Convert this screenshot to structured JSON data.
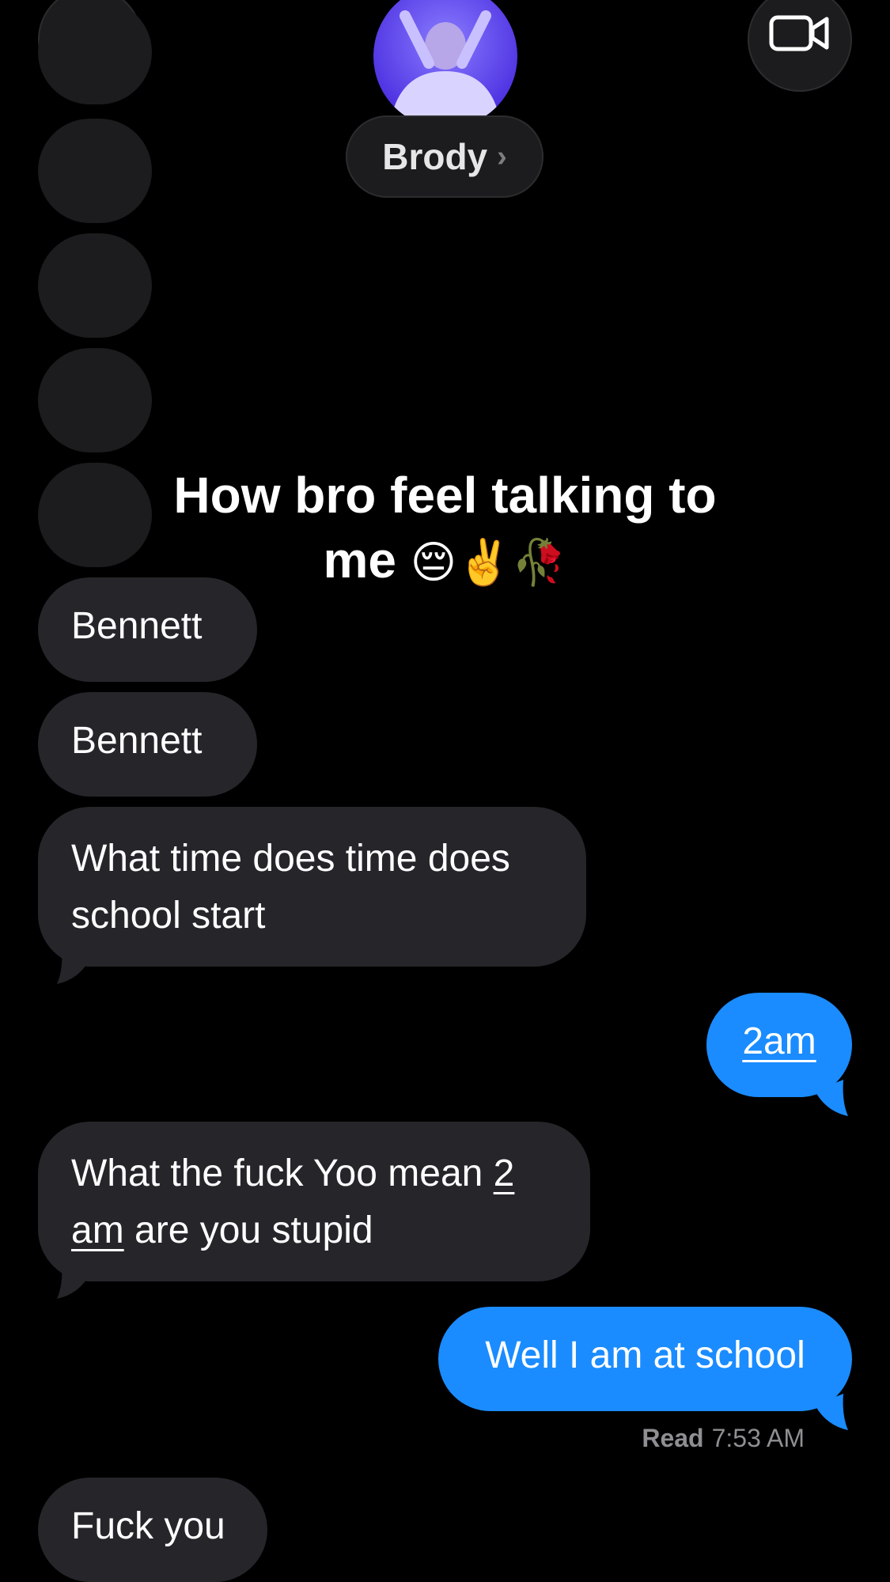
{
  "header": {
    "contact_name": "Brody",
    "chevron": "›",
    "back_icon": "chevron-left-icon",
    "video_icon": "video-camera-icon"
  },
  "caption": {
    "text": "How bro feel talking to me",
    "emojis": "😔✌️🥀"
  },
  "messages": [
    {
      "direction": "in",
      "text": "Bennett"
    },
    {
      "direction": "in",
      "text": "Bennett"
    },
    {
      "direction": "in",
      "line1": "What time does time does",
      "line2": "school start"
    },
    {
      "direction": "out",
      "text": "2am"
    },
    {
      "direction": "in",
      "line1_a": "What the fuck Yoo mean ",
      "line1_b": "2",
      "line2_a": "am",
      "line2_b": " are you stupid"
    },
    {
      "direction": "out",
      "text": "Well I am at school"
    },
    {
      "direction": "in",
      "text": "Fuck you"
    }
  ],
  "receipt": {
    "label": "Read",
    "time": "7:53 AM"
  },
  "colors": {
    "background": "#000000",
    "incoming_bubble": "#26252a",
    "outgoing_bubble": "#1a8cff",
    "secondary_text": "#8e8e93"
  }
}
